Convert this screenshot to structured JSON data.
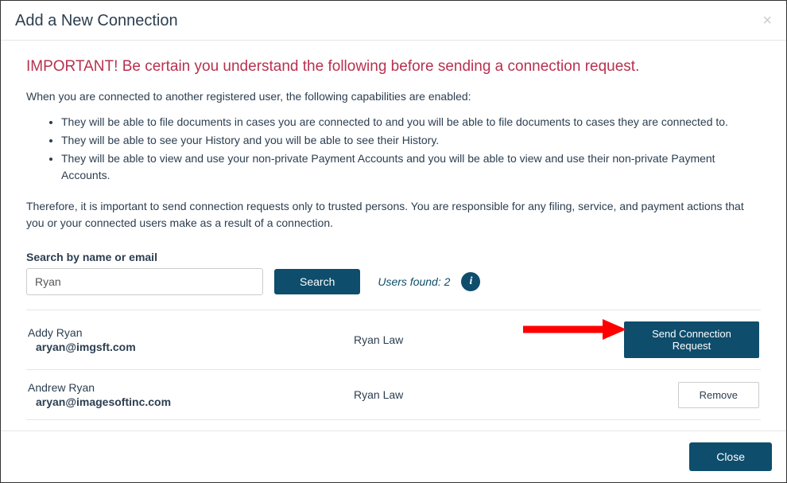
{
  "modal": {
    "title": "Add a New Connection",
    "close_x": "×"
  },
  "warning": {
    "heading": "IMPORTANT! Be certain you understand the following before sending a connection request.",
    "intro": "When you are connected to another registered user, the following capabilities are enabled:",
    "bullets": [
      "They will be able to file documents in cases you are connected to and you will be able to file documents to cases they are connected to.",
      "They will be able to see your History and you will be able to see their History.",
      "They will be able to view and use your non-private Payment Accounts and you will be able to view and use their non-private Payment Accounts."
    ],
    "conclusion": "Therefore, it is important to send connection requests only to trusted persons. You are responsible for any filing, service, and payment actions that you or your connected users make as a result of a connection."
  },
  "search": {
    "label": "Search by name or email",
    "value": "Ryan",
    "button": "Search",
    "found_text": "Users found: 2",
    "info_icon": "i"
  },
  "results": [
    {
      "name": "Addy Ryan",
      "email": "aryan@imgsft.com",
      "org": "Ryan Law",
      "action_label": "Send Connection Request",
      "action_type": "send"
    },
    {
      "name": "Andrew Ryan",
      "email": "aryan@imagesoftinc.com",
      "org": "Ryan Law",
      "action_label": "Remove",
      "action_type": "remove"
    }
  ],
  "footer": {
    "close": "Close"
  }
}
